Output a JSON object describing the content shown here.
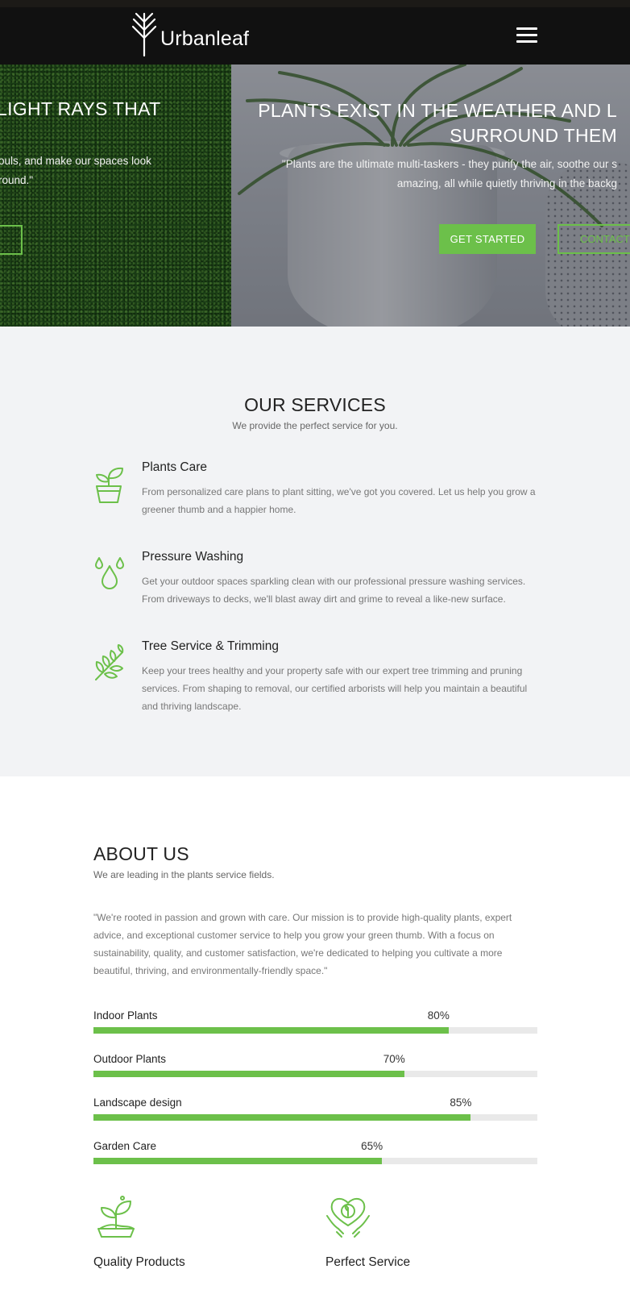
{
  "header": {
    "brand": "Urbanleaf",
    "logo_icon": "tree-branch-icon",
    "menu_icon": "hamburger-menu-icon"
  },
  "hero": {
    "prev_slide": {
      "title": "LIGHT RAYS THAT",
      "text_line1": "ouls, and make our spaces look",
      "text_line2": "round.\""
    },
    "current_slide": {
      "title_line1": "PLANTS EXIST IN THE WEATHER AND L",
      "title_line2": "SURROUND THEM",
      "text_line1": "\"Plants are the ultimate multi-taskers - they purify the air, soothe our s",
      "text_line2": "amazing, all while quietly thriving in the backg",
      "primary_button": "GET STARTED",
      "secondary_button": "CONTACT US"
    }
  },
  "services": {
    "title": "OUR SERVICES",
    "subtitle": "We provide the perfect service for you.",
    "items": [
      {
        "icon": "potted-plant-icon",
        "title": "Plants Care",
        "description": "From personalized care plans to plant sitting, we've got you covered. Let us help you grow a greener thumb and a happier home."
      },
      {
        "icon": "water-drops-icon",
        "title": "Pressure Washing",
        "description": "Get your outdoor spaces sparkling clean with our professional pressure washing services. From driveways to decks, we'll blast away dirt and grime to reveal a like-new surface."
      },
      {
        "icon": "leaf-branch-icon",
        "title": "Tree Service & Trimming",
        "description": "Keep your trees healthy and your property safe with our expert tree trimming and pruning services. From shaping to removal, our certified arborists will help you maintain a beautiful and thriving landscape."
      }
    ]
  },
  "about": {
    "title": "ABOUT US",
    "subtitle": "We are leading in the plants service fields.",
    "text": "\"We're rooted in passion and grown with care. Our mission is to provide high-quality plants, expert advice, and exceptional customer service to help you grow your green thumb. With a focus on sustainability, quality, and customer satisfaction, we're dedicated to helping you cultivate a more beautiful, thriving, and environmentally-friendly space.\"",
    "skills": [
      {
        "label": "Indoor Plants",
        "percent_text": "80%",
        "value": 0.8
      },
      {
        "label": "Outdoor Plants",
        "percent_text": "70%",
        "value": 0.7
      },
      {
        "label": "Landscape design",
        "percent_text": "85%",
        "value": 0.85
      },
      {
        "label": "Garden Care",
        "percent_text": "65%",
        "value": 0.65
      }
    ],
    "features": [
      {
        "icon": "sprout-in-hand-icon",
        "title": "Quality Products"
      },
      {
        "icon": "heart-leaf-hands-icon",
        "title": "Perfect Service"
      }
    ]
  },
  "colors": {
    "accent": "#6cc04a",
    "header_bg": "#111111",
    "services_bg": "#f2f3f5",
    "track": "#e9e9e9"
  }
}
